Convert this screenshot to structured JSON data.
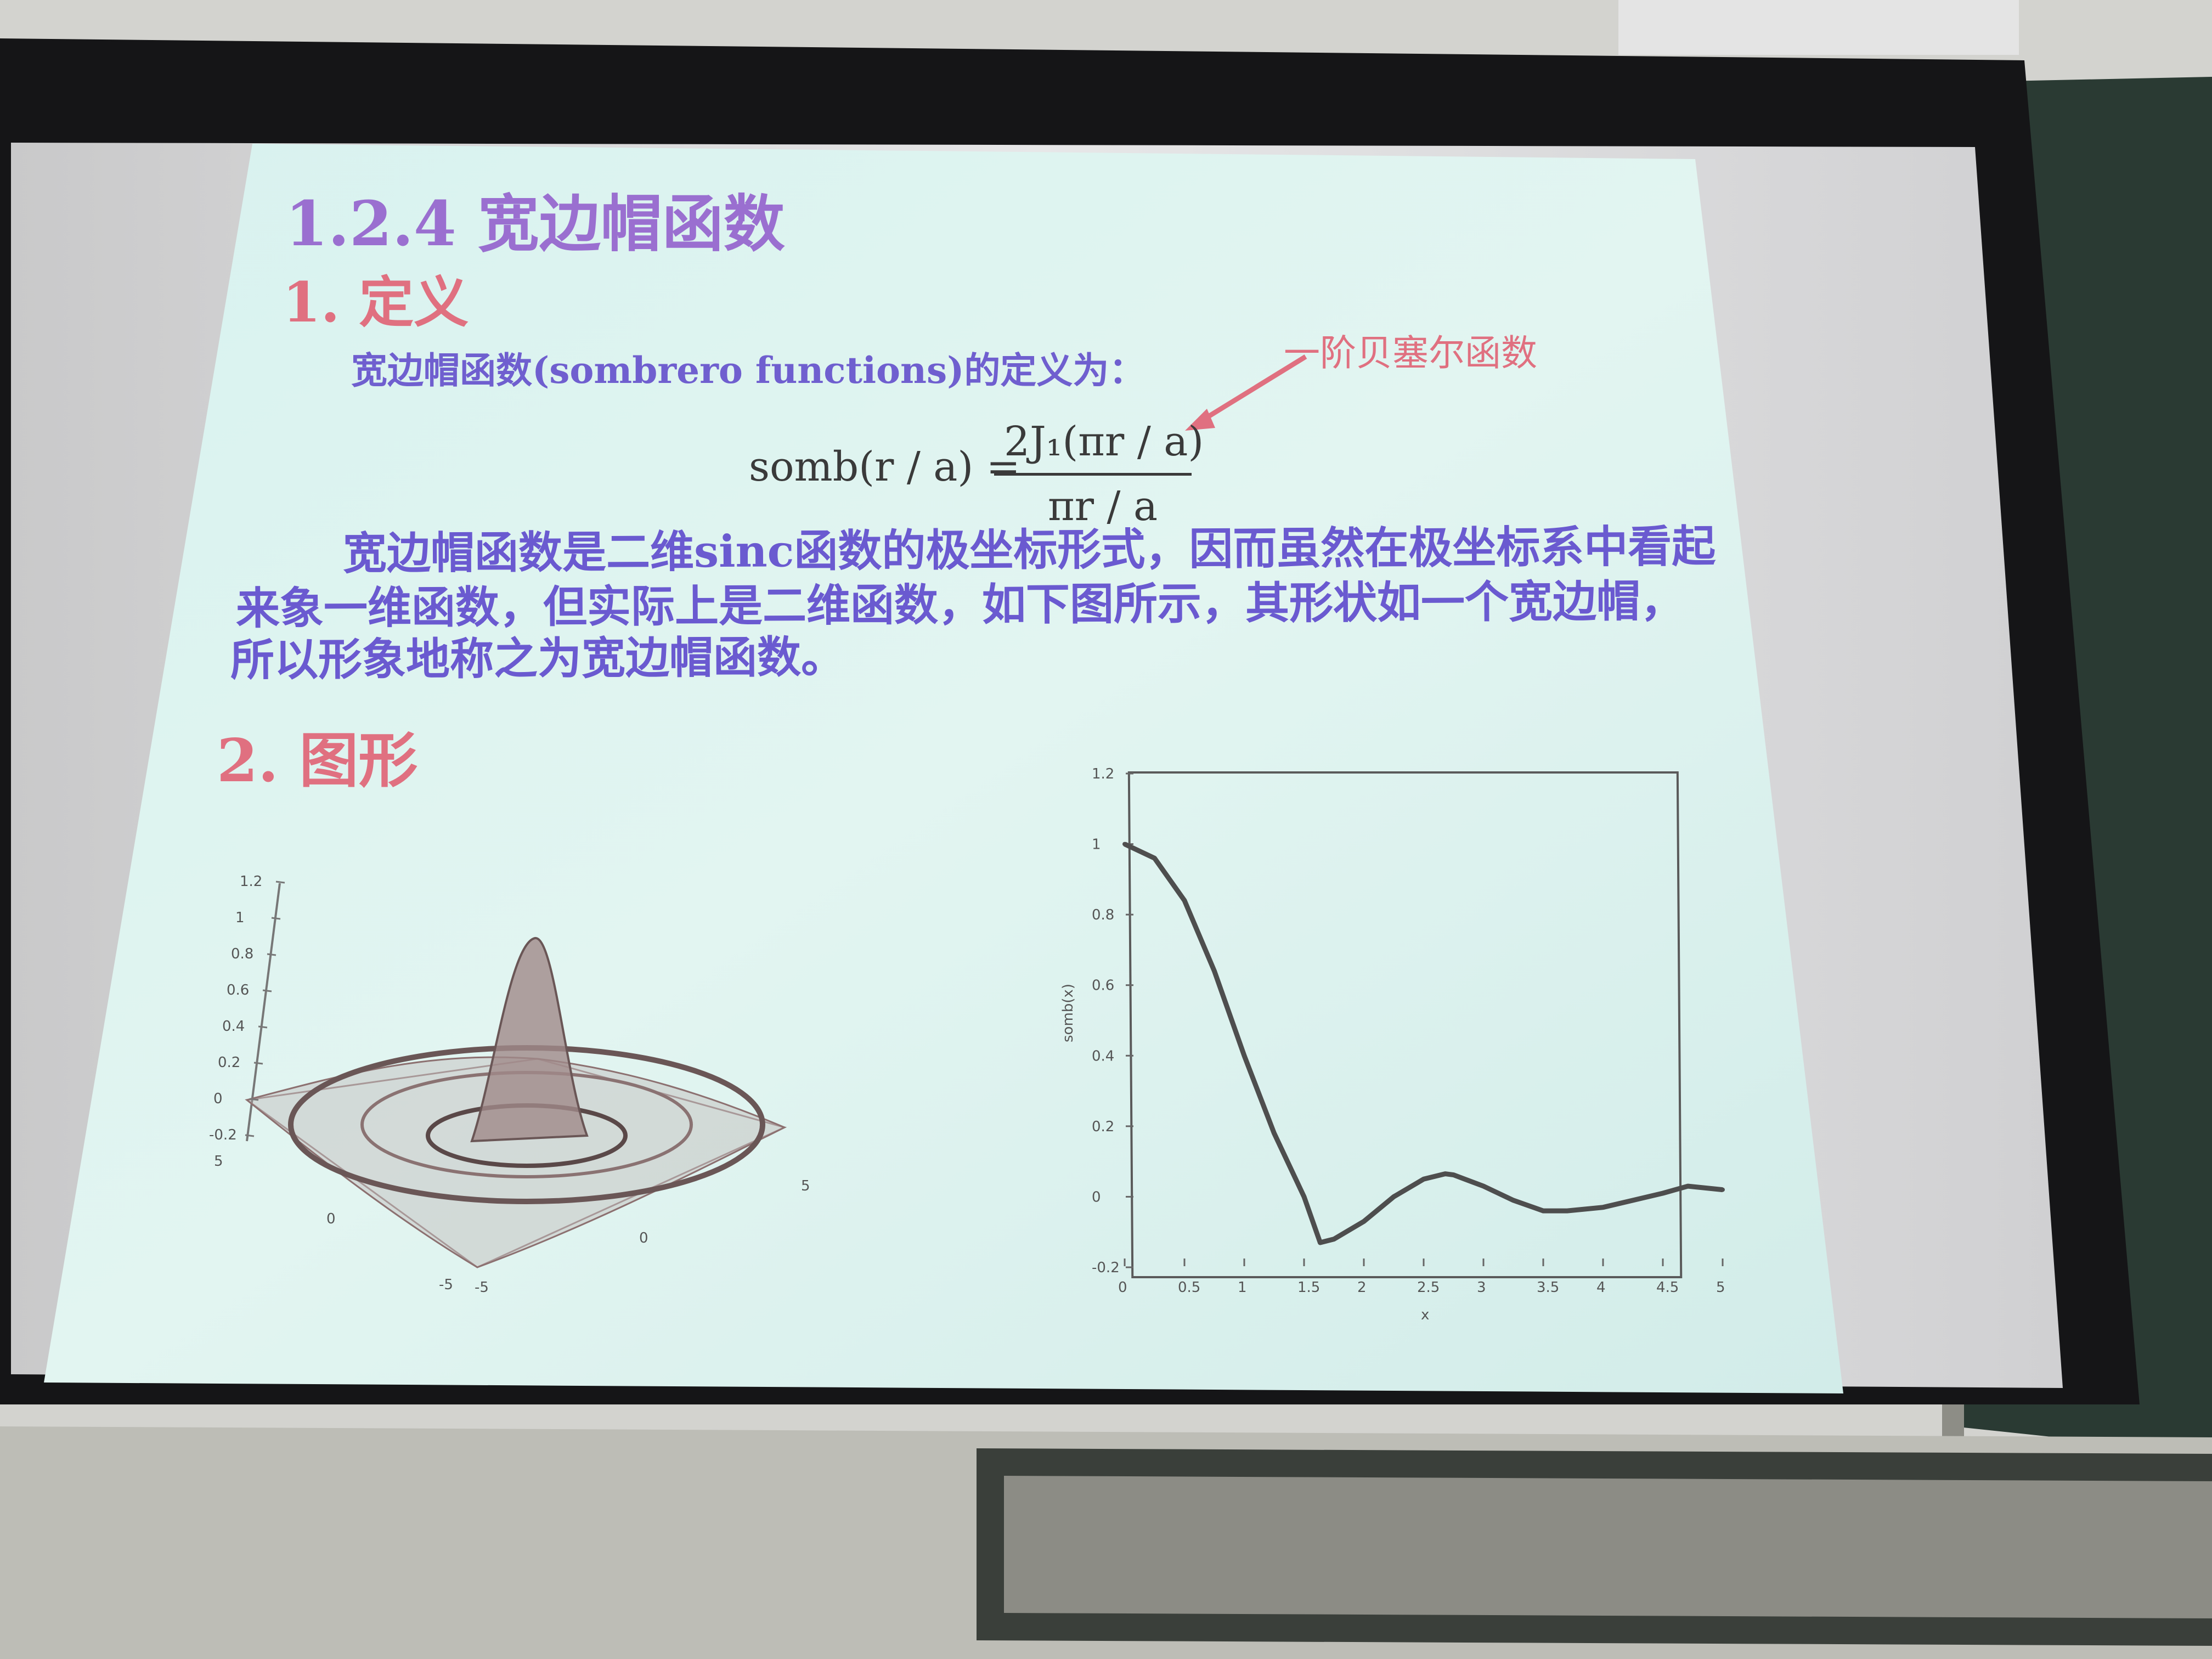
{
  "slide": {
    "section_title": "1.2.4  宽边帽函数",
    "subsection_definition": "1. 定义",
    "intro_line": "宽边帽函数(sombrero functions)的定义为：",
    "annotation": "一阶贝塞尔函数",
    "formula": {
      "lhs": "somb(r / a) =",
      "numerator": "2J₁(πr / a)",
      "denominator": "πr / a"
    },
    "paragraph_lines": [
      "宽边帽函数是二维sinc函数的极坐标形式，因而虽然在极坐标系中看起",
      "来象一维函数，但实际上是二维函数，如下图所示，其形状如一个宽边帽，",
      "所以形象地称之为宽边帽函数。"
    ],
    "subsection_graph": "2. 图形"
  },
  "surface_plot": {
    "z_ticks": [
      "1.2",
      "1",
      "0.8",
      "0.6",
      "0.4",
      "0.2",
      "0",
      "-0.2"
    ],
    "x_ticks": [
      "5",
      "0",
      "-5"
    ],
    "y_ticks": [
      "-5",
      "0",
      "5"
    ]
  },
  "chart_data": {
    "type": "line",
    "title": "",
    "xlabel": "x",
    "ylabel": "somb(x)",
    "xlim": [
      0,
      5
    ],
    "ylim": [
      -0.2,
      1.2
    ],
    "x_ticks": [
      "0",
      "0.5",
      "1",
      "1.5",
      "2",
      "2.5",
      "3",
      "3.5",
      "4",
      "4.5",
      "5"
    ],
    "y_ticks": [
      "1.2",
      "1",
      "0.8",
      "0.6",
      "0.4",
      "0.2",
      "0",
      "-0.2"
    ],
    "series": [
      {
        "x": [
          0,
          0.25,
          0.5,
          0.75,
          1.0,
          1.25,
          1.5,
          1.635,
          1.75,
          2.0,
          2.25,
          2.5,
          2.68,
          2.75,
          3.0,
          3.25,
          3.5,
          3.7,
          4.0,
          4.25,
          4.5,
          4.71,
          5.0
        ],
        "y": [
          1.0,
          0.96,
          0.84,
          0.64,
          0.4,
          0.18,
          0.0,
          -0.13,
          -0.12,
          -0.07,
          0.0,
          0.05,
          0.065,
          0.062,
          0.03,
          -0.01,
          -0.04,
          -0.04,
          -0.03,
          -0.01,
          0.01,
          0.03,
          0.02
        ]
      }
    ]
  }
}
